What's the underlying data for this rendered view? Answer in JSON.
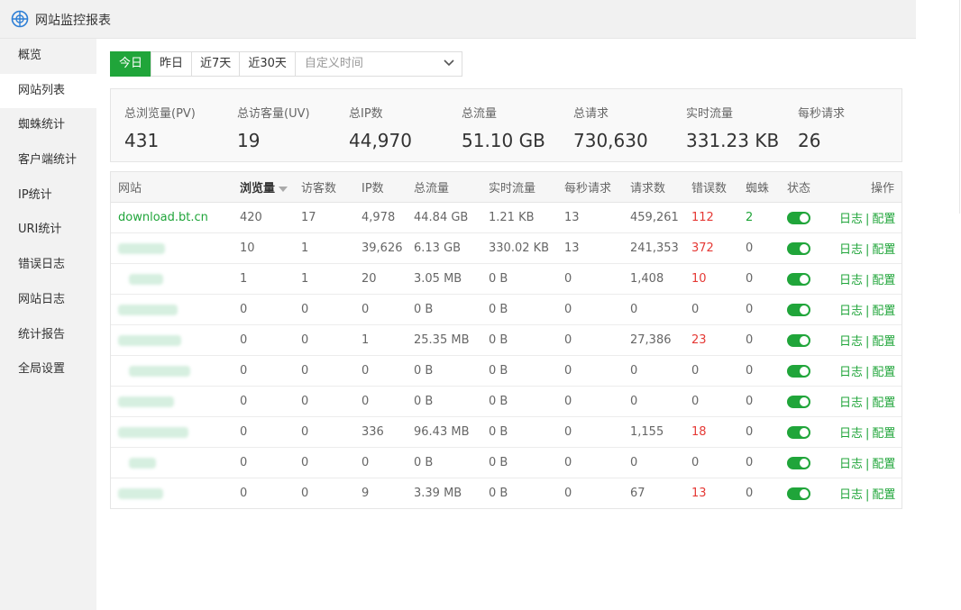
{
  "app": {
    "title": "网站监控报表",
    "logo": "globe-icon"
  },
  "colors": {
    "accent": "#20a53a",
    "error": "#e53935"
  },
  "sidebar": {
    "items": [
      {
        "label": "概览"
      },
      {
        "label": "网站列表",
        "active": true
      },
      {
        "label": "蜘蛛统计"
      },
      {
        "label": "客户端统计"
      },
      {
        "label": "IP统计"
      },
      {
        "label": "URI统计"
      },
      {
        "label": "错误日志"
      },
      {
        "label": "网站日志"
      },
      {
        "label": "统计报告"
      },
      {
        "label": "全局设置"
      }
    ]
  },
  "toolbar": {
    "tabs": [
      "今日",
      "昨日",
      "近7天",
      "近30天"
    ],
    "active_tab": "今日",
    "custom_time_placeholder": "自定义时间"
  },
  "summary": [
    {
      "label": "总浏览量(PV)",
      "value": "431"
    },
    {
      "label": "总访客量(UV)",
      "value": "19"
    },
    {
      "label": "总IP数",
      "value": "44,970"
    },
    {
      "label": "总流量",
      "value": "51.10 GB"
    },
    {
      "label": "总请求",
      "value": "730,630"
    },
    {
      "label": "实时流量",
      "value": "331.23 KB"
    },
    {
      "label": "每秒请求",
      "value": "26"
    }
  ],
  "table": {
    "columns": [
      "网站",
      "浏览量",
      "访客数",
      "IP数",
      "总流量",
      "实时流量",
      "每秒请求",
      "请求数",
      "错误数",
      "蜘蛛",
      "状态",
      "操作"
    ],
    "sorted_column": "浏览量",
    "op_log": "日志",
    "op_config": "配置",
    "rows": [
      {
        "site": "download.bt.cn",
        "pv": "420",
        "uv": "17",
        "ip": "4,978",
        "traffic": "44.84 GB",
        "realtime": "1.21 KB",
        "qps": "13",
        "requests": "459,261",
        "errors": "112",
        "spider": "2",
        "enabled": true
      },
      {
        "site": "",
        "pv": "10",
        "uv": "1",
        "ip": "39,626",
        "traffic": "6.13 GB",
        "realtime": "330.02 KB",
        "qps": "13",
        "requests": "241,353",
        "errors": "372",
        "spider": "0",
        "enabled": true
      },
      {
        "site": "",
        "pv": "1",
        "uv": "1",
        "ip": "20",
        "traffic": "3.05 MB",
        "realtime": "0 B",
        "qps": "0",
        "requests": "1,408",
        "errors": "10",
        "spider": "0",
        "enabled": true
      },
      {
        "site": "",
        "pv": "0",
        "uv": "0",
        "ip": "0",
        "traffic": "0 B",
        "realtime": "0 B",
        "qps": "0",
        "requests": "0",
        "errors": "0",
        "spider": "0",
        "enabled": true
      },
      {
        "site": "",
        "pv": "0",
        "uv": "0",
        "ip": "1",
        "traffic": "25.35 MB",
        "realtime": "0 B",
        "qps": "0",
        "requests": "27,386",
        "errors": "23",
        "spider": "0",
        "enabled": true
      },
      {
        "site": "",
        "pv": "0",
        "uv": "0",
        "ip": "0",
        "traffic": "0 B",
        "realtime": "0 B",
        "qps": "0",
        "requests": "0",
        "errors": "0",
        "spider": "0",
        "enabled": true
      },
      {
        "site": "",
        "pv": "0",
        "uv": "0",
        "ip": "0",
        "traffic": "0 B",
        "realtime": "0 B",
        "qps": "0",
        "requests": "0",
        "errors": "0",
        "spider": "0",
        "enabled": true
      },
      {
        "site": "",
        "pv": "0",
        "uv": "0",
        "ip": "336",
        "traffic": "96.43 MB",
        "realtime": "0 B",
        "qps": "0",
        "requests": "1,155",
        "errors": "18",
        "spider": "0",
        "enabled": true
      },
      {
        "site": "",
        "pv": "0",
        "uv": "0",
        "ip": "0",
        "traffic": "0 B",
        "realtime": "0 B",
        "qps": "0",
        "requests": "0",
        "errors": "0",
        "spider": "0",
        "enabled": true
      },
      {
        "site": "",
        "pv": "0",
        "uv": "0",
        "ip": "9",
        "traffic": "3.39 MB",
        "realtime": "0 B",
        "qps": "0",
        "requests": "67",
        "errors": "13",
        "spider": "0",
        "enabled": true
      }
    ]
  }
}
